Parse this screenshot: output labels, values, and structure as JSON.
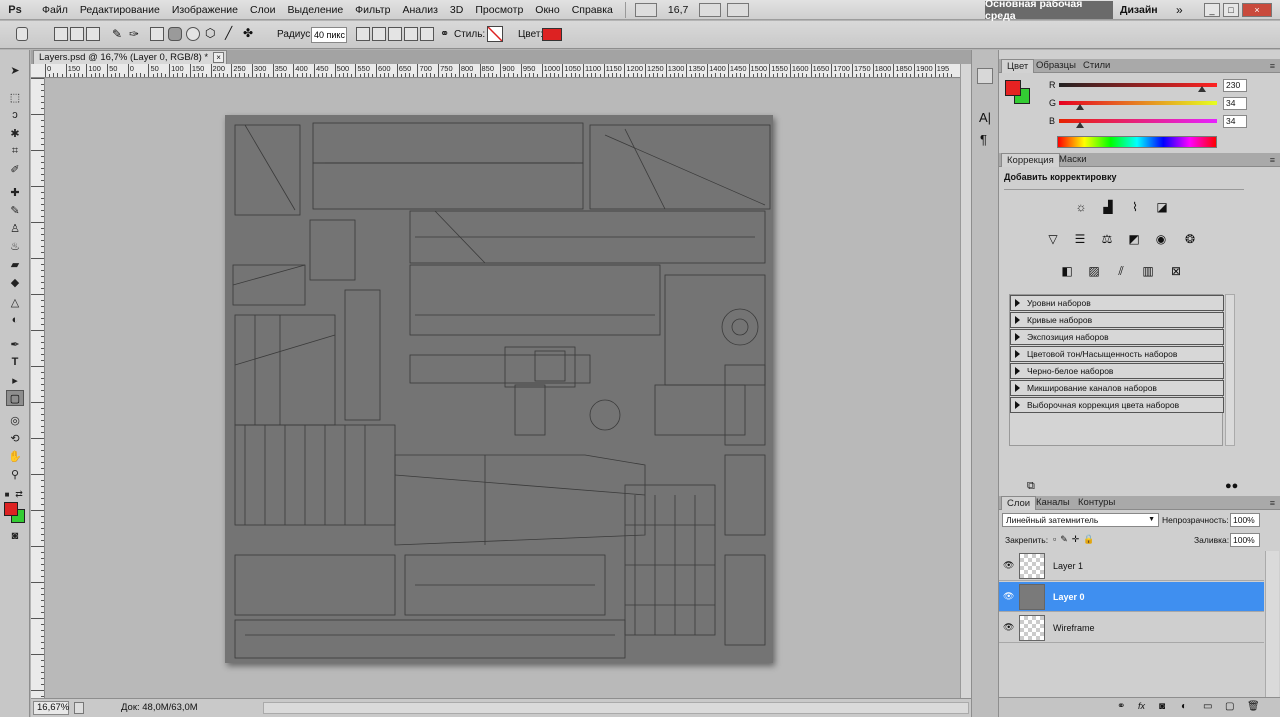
{
  "app": {
    "logo": "Ps"
  },
  "menu": [
    "Файл",
    "Редактирование",
    "Изображение",
    "Слои",
    "Выделение",
    "Фильтр",
    "Анализ",
    "3D",
    "Просмотр",
    "Окно",
    "Справка"
  ],
  "menubar": {
    "zoom": "16,7",
    "workspace_active": "Основная рабочая среда",
    "workspace_design": "Дизайн",
    "more": "»"
  },
  "options": {
    "radius_label": "Радиус:",
    "radius_value": "40 пикс",
    "style_label": "Стиль:",
    "color_label": "Цвет:",
    "color": "#dd2222"
  },
  "document": {
    "tab_title": "Layers.psd @ 16,7% (Layer 0, RGB/8) *",
    "close": "×"
  },
  "ruler": {
    "h_labels": [
      "0",
      "150",
      "100",
      "50",
      "0",
      "50",
      "100",
      "150",
      "200",
      "250",
      "300",
      "350",
      "400",
      "450",
      "500",
      "550",
      "600",
      "650",
      "700",
      "750",
      "800",
      "850",
      "900",
      "950",
      "1000",
      "1050",
      "1100",
      "1150",
      "1200",
      "1250",
      "1300",
      "1350",
      "1400",
      "1450",
      "1500",
      "1550",
      "1600",
      "1650",
      "1700",
      "1750",
      "1800",
      "1850",
      "1900",
      "195"
    ]
  },
  "status": {
    "zoom": "16,67%",
    "doc_info": "Док: 48,0M/63,0M"
  },
  "colors": {
    "foreground": "#dd2222",
    "background": "#33cc33"
  },
  "color_panel": {
    "tabs": [
      "Цвет",
      "Образцы",
      "Стили"
    ],
    "r_label": "R",
    "g_label": "G",
    "b_label": "B",
    "r": "230",
    "g": "34",
    "b": "34",
    "fg": "#e62222",
    "bg": "#33cc33"
  },
  "adjust_panel": {
    "tabs": [
      "Коррекция",
      "Маски"
    ],
    "heading": "Добавить корректировку",
    "presets": [
      "Уровни наборов",
      "Кривые наборов",
      "Экспозиция наборов",
      "Цветовой тон/Насыщенность наборов",
      "Черно-белое наборов",
      "Микширование каналов наборов",
      "Выборочная коррекция цвета наборов"
    ]
  },
  "layers_panel": {
    "tabs": [
      "Слои",
      "Каналы",
      "Контуры"
    ],
    "blend_mode": "Линейный затемнитель",
    "opacity_label": "Непрозрачность:",
    "opacity": "100%",
    "lock_label": "Закрепить:",
    "fill_label": "Заливка:",
    "fill": "100%",
    "layers": [
      {
        "name": "Layer 1",
        "selected": false,
        "thumb": "checker"
      },
      {
        "name": "Layer 0",
        "selected": true,
        "thumb": "grey"
      },
      {
        "name": "Wireframe",
        "selected": false,
        "thumb": "checker"
      }
    ]
  }
}
